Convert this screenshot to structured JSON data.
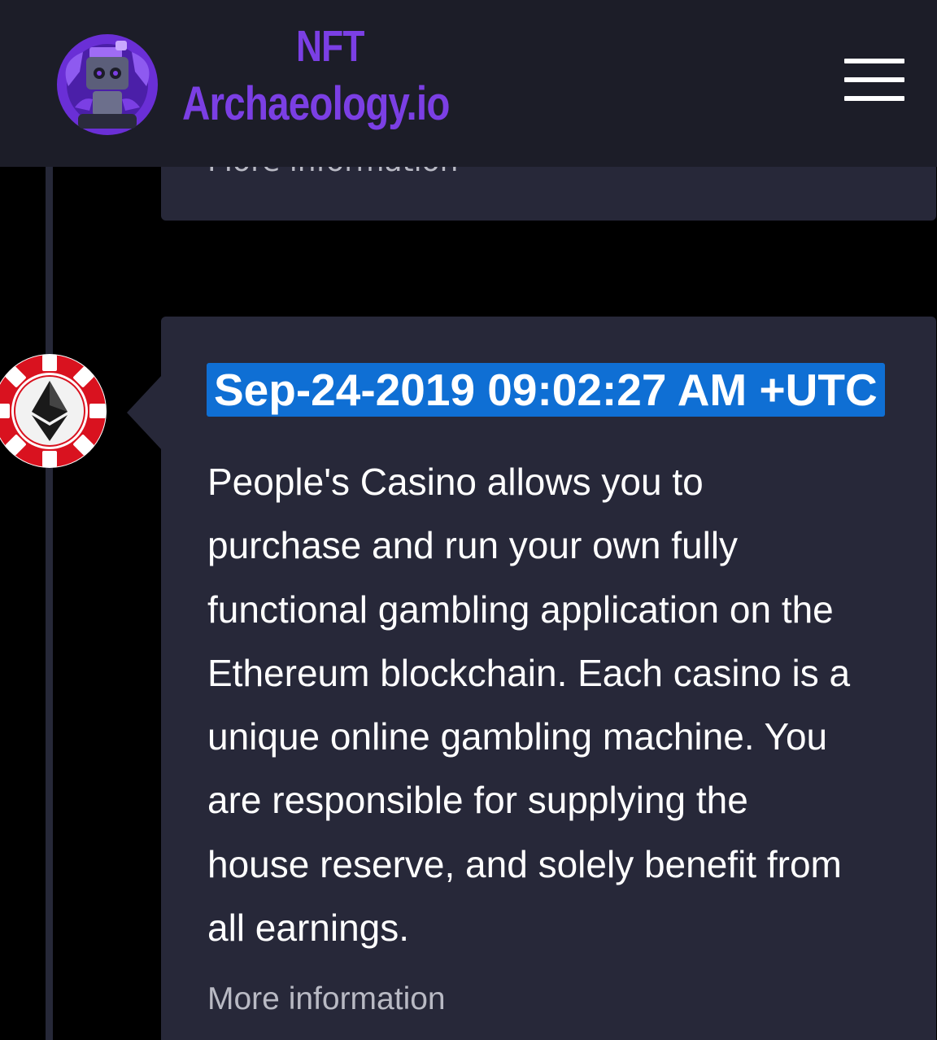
{
  "header": {
    "logo_line1": "NFT",
    "logo_line2": "Archaeology.io",
    "brand_color": "#7b3fe4",
    "menu_icon": "hamburger-icon"
  },
  "previous_card": {
    "more_info_label": "More information"
  },
  "entry": {
    "avatar_icon": "ethereum-casino-chip-icon",
    "timestamp": "Sep-24-2019 09:02:27 AM +UTC",
    "description": "People's Casino allows you to purchase and run your own fully functional gambling application on the Ethereum blockchain. Each casino is a unique online gambling machine. You are responsible for supplying the house reserve, and solely benefit from all earnings.",
    "more_info_label": "More information",
    "timestamp_bg": "#0f6fd4",
    "card_bg": "#272839"
  }
}
